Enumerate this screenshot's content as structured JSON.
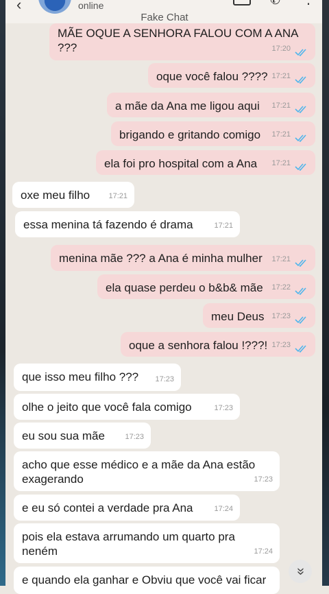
{
  "header": {
    "status": "online",
    "title": "Fake Chat"
  },
  "icons": {
    "back": "back-arrow-icon",
    "video": "video-call-icon",
    "call": "phone-icon",
    "more": "more-icon",
    "ticks": "double-check-icon",
    "scroll": "scroll-down-icon"
  },
  "colors": {
    "outgoing": "#f6d8d8",
    "incoming": "#ffffff",
    "ticks": "#4fb6ec",
    "background": "#ece8e2"
  },
  "messages": [
    {
      "dir": "out",
      "text": "MÃE OQUE A SENHORA FALOU COM A ANA ???",
      "time": "17:20"
    },
    {
      "dir": "out",
      "text": "oque você falou ????",
      "time": "17:21"
    },
    {
      "dir": "out",
      "text": "a mãe da Ana me ligou aqui",
      "time": "17:21"
    },
    {
      "dir": "out",
      "text": "brigando e gritando comigo",
      "time": "17:21"
    },
    {
      "dir": "out",
      "text": "ela foi pro hospital com a Ana",
      "time": "17:21"
    },
    {
      "dir": "in",
      "text": "oxe meu filho",
      "time": "17:21"
    },
    {
      "dir": "in",
      "text": "essa menina tá fazendo é drama",
      "time": "17:21"
    },
    {
      "dir": "out",
      "text": "menina mãe ??? a Ana é minha mulher",
      "time": "17:21"
    },
    {
      "dir": "out",
      "text": "ela quase perdeu o b&b& mãe",
      "time": "17:22"
    },
    {
      "dir": "out",
      "text": "meu Deus",
      "time": "17:23"
    },
    {
      "dir": "out",
      "text": "oque a senhora falou !???!",
      "time": "17:23"
    },
    {
      "dir": "in",
      "text": "que isso meu filho ???",
      "time": "17:23"
    },
    {
      "dir": "in",
      "text": "olhe o jeito que você fala comigo",
      "time": "17:23"
    },
    {
      "dir": "in",
      "text": "eu sou sua mãe",
      "time": "17:23"
    },
    {
      "dir": "in",
      "text": "acho que esse médico e a mãe da Ana estão exagerando",
      "time": "17:23"
    },
    {
      "dir": "in",
      "text": "e eu só contei a verdade pra Ana",
      "time": "17:24"
    },
    {
      "dir": "in",
      "text": "pois ela estava arrumando um quarto pra neném",
      "time": "17:24"
    },
    {
      "dir": "in",
      "text": "e quando ela ganhar e Obviu que você vai ficar",
      "time": ""
    }
  ]
}
